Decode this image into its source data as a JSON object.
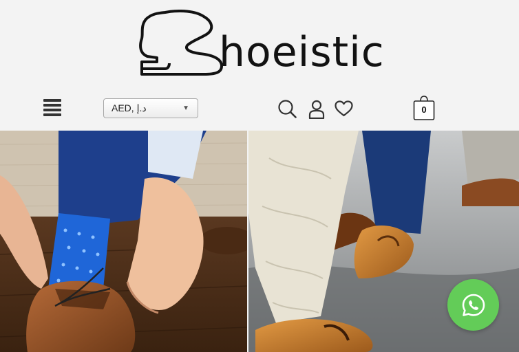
{
  "brand": {
    "logo_text": "hoeistic"
  },
  "toolbar": {
    "currency_selected": "AED, د.إ",
    "cart_count": "0"
  },
  "icons": {
    "menu": "hamburger-menu-icon",
    "search": "search-icon",
    "account": "user-icon",
    "wishlist": "heart-icon",
    "cart": "shopping-bag-icon",
    "chat": "whatsapp-icon"
  },
  "colors": {
    "background": "#f3f3f3",
    "whatsapp": "#63cc58",
    "text": "#121212"
  }
}
